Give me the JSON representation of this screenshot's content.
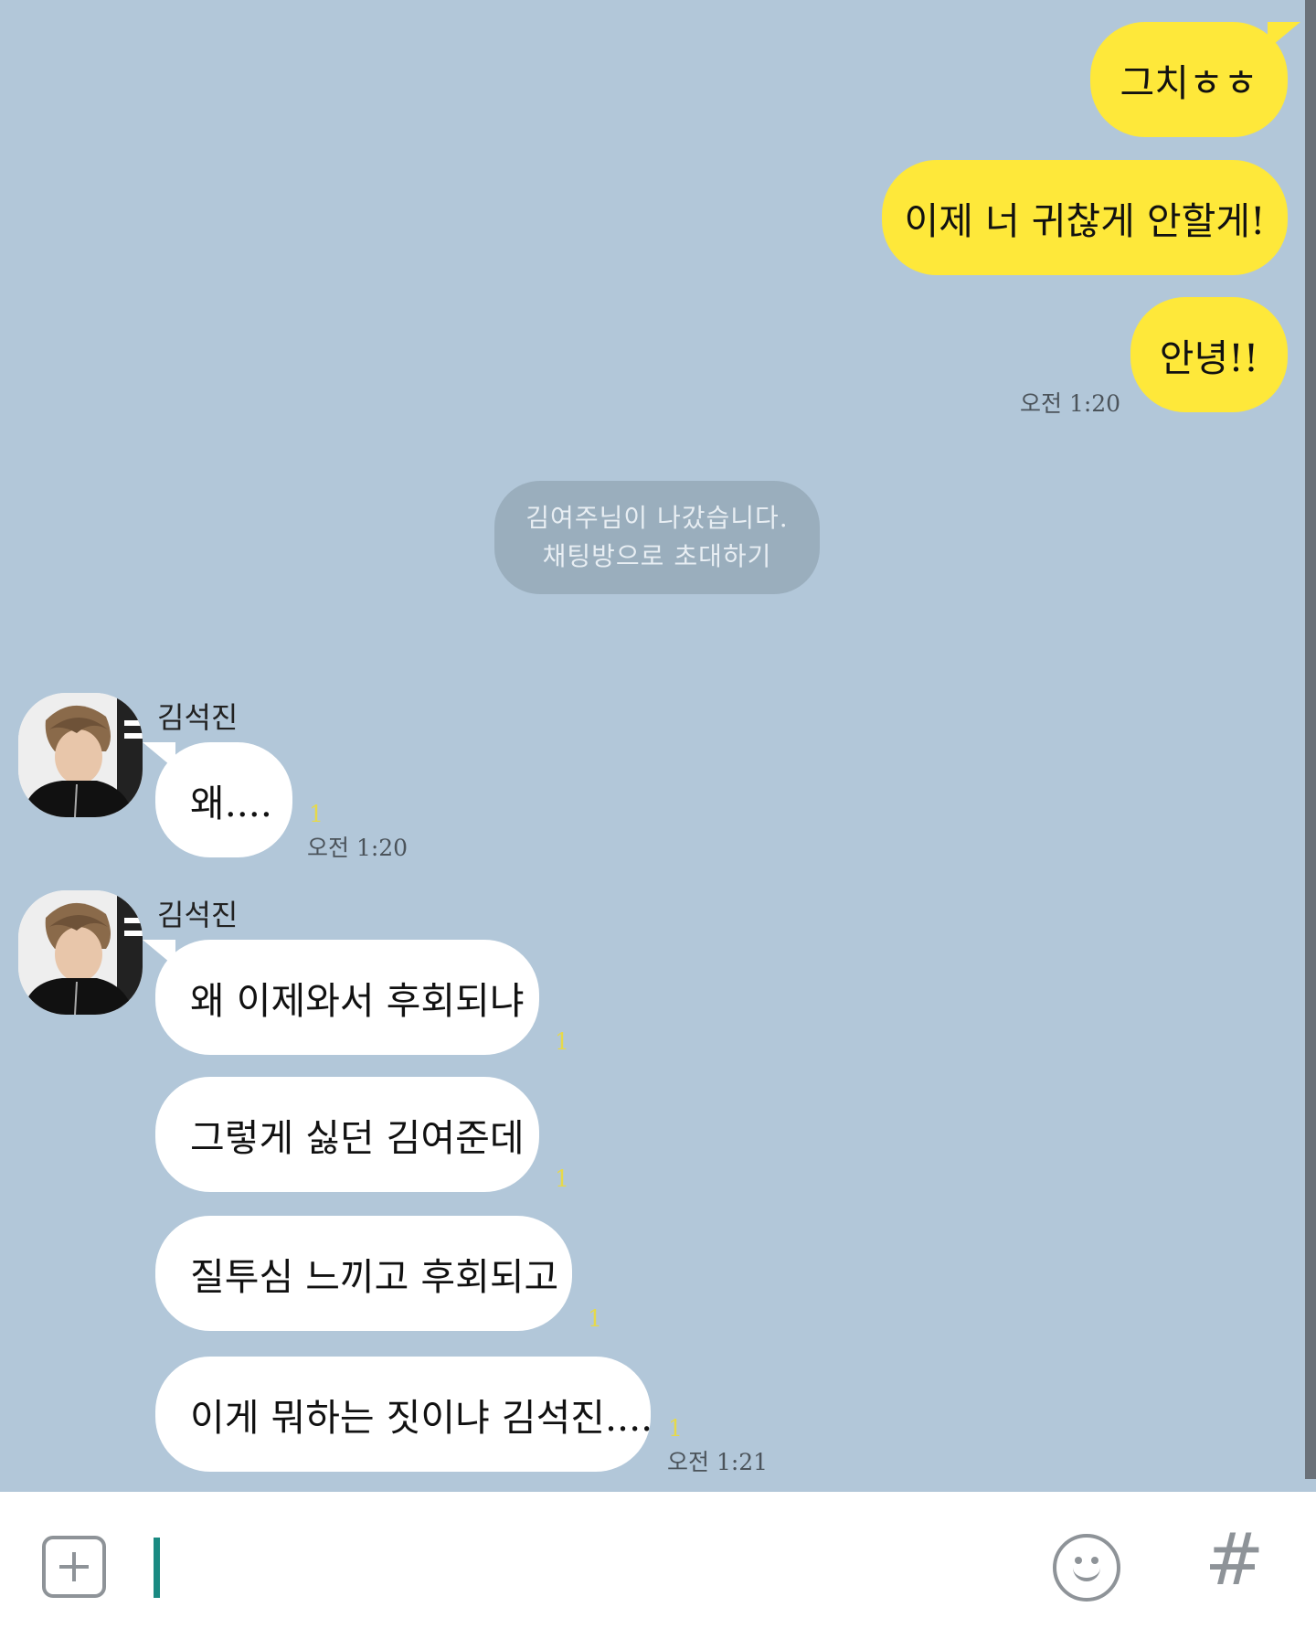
{
  "messages_out": [
    {
      "text": "그치ㅎㅎ"
    },
    {
      "text": "이제 너 귀찮게 안할게!"
    },
    {
      "text": "안녕!!"
    }
  ],
  "messages_out_time": "오전 1:20",
  "system_notice": {
    "line1": "김여주님이 나갔습니다.",
    "line2": "채팅방으로 초대하기"
  },
  "group1": {
    "sender": "김석진",
    "text": "왜....",
    "unread": "1",
    "time": "오전 1:20"
  },
  "group2": {
    "sender": "김석진",
    "messages": [
      {
        "text": "왜 이제와서 후회되냐",
        "unread": "1"
      },
      {
        "text": "그렇게 싫던 김여준데",
        "unread": "1"
      },
      {
        "text": "질투심 느끼고 후회되고",
        "unread": "1"
      },
      {
        "text": "이게 뭐하는 짓이냐 김석진....",
        "unread": "1"
      }
    ],
    "time": "오전 1:21"
  },
  "input_bar": {
    "plus_icon": "plus-square-icon",
    "emoji_icon": "smiley-icon",
    "hash_label": "#"
  },
  "colors": {
    "background": "#b2c7d9",
    "my_bubble": "#fee83a",
    "their_bubble": "#ffffff",
    "unread": "#e6d94a"
  }
}
